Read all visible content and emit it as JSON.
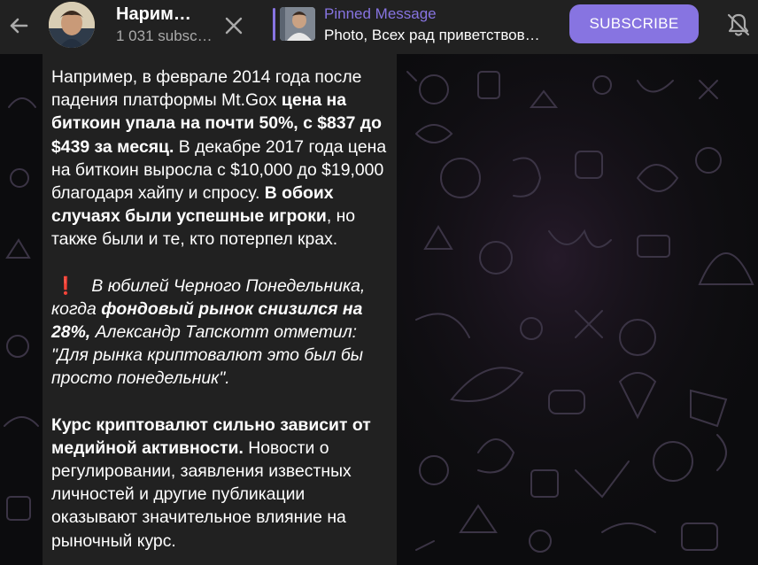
{
  "header": {
    "channel_name": "Нарим…",
    "subscribers": "1 031 subsc…",
    "pinned_title": "Pinned Message",
    "pinned_text": "Photo, Всех рад приветствов…",
    "subscribe_label": "SUBSCRIBE"
  },
  "message": {
    "p1_a": "Например, в феврале 2014 года после падения платформы Mt.Gox ",
    "p1_b": "цена на биткоин упала на почти 50%, с $837 до $439 за месяц.",
    "p1_c": " В декабре 2017 года цена на биткоин выросла с $10,000 до $19,000 благодаря хайпу и спросу. ",
    "p1_d": "В обоих случаях были успешные игроки",
    "p1_e": ", но также были и те, кто потерпел крах.",
    "p2_exclaim": "❗",
    "p2_a": " В юбилей Черного Понедельника, когда ",
    "p2_b": "фондовый рынок снизился на 28%,",
    "p2_c": " Александр Тапскотт отметил: \"Для рынка криптовалют это был бы просто понедельник\".",
    "p3_a": "Курс криптовалют сильно зависит от медийной активности.",
    "p3_b": " Новости о регулировании, заявления известных личностей и другие публикации оказывают значительное влияние на рыночный курс."
  },
  "colors": {
    "accent": "#8774e1",
    "panel": "#212121",
    "background": "#0e0e10",
    "exclaim": "#e53935"
  },
  "icons": [
    "arrow-left-icon",
    "close-icon",
    "bell-off-icon"
  ]
}
